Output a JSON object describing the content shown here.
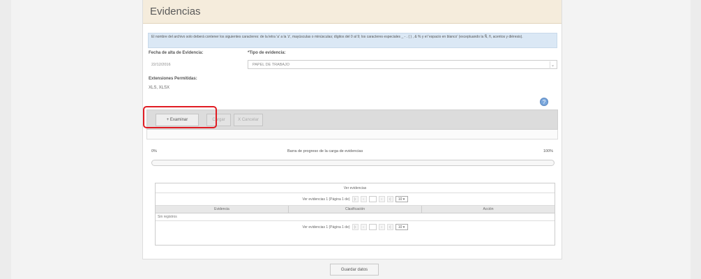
{
  "panel": {
    "title": "Evidencias",
    "notice": "El nombre del archivo solo deberá contener los siguientes caracteres: de la letra 'a' a la 'z', mayúsculas o minúsculas; dígitos del 0 al 9; los caracteres especiales _ - . ( ) , & % y el 'espacio en blanco' (exceptuando la Ñ, ñ, acentos y diéresis)."
  },
  "form": {
    "fecha_label": "Fecha de alta de Evidencia:",
    "fecha_value": "22/12/2016",
    "tipo_label": "*Tipo de evidencia:",
    "tipo_value": "PAPEL DE TRABAJO",
    "ext_label": "Extensiones Permitidas:",
    "ext_value": "XLS, XLSX"
  },
  "toolbar": {
    "examinar": "+ Examinar",
    "cargar": "Cargar",
    "cancelar": "X Cancelar"
  },
  "progress": {
    "min_label": "0%",
    "title": "Barra de progreso de la carga de evidencias",
    "max_label": "100%",
    "value": 0
  },
  "grid": {
    "caption": "Ver evidencias",
    "pager_text": "Ver evidencias 1 (Página 1 de)",
    "page_size": "10",
    "columns": [
      "Evidencia",
      "Clasificación",
      "Acción"
    ],
    "empty_text": "Sin registros"
  },
  "footer": {
    "save": "Guardar datos"
  },
  "colors": {
    "header_bg": "#f5ecdc",
    "notice_bg": "#dbe8f5",
    "highlight": "#e01b22",
    "help_icon": "#7aa7dc"
  },
  "icons": {
    "help": "info-circle-icon",
    "dropdown": "chevron-down-icon"
  }
}
